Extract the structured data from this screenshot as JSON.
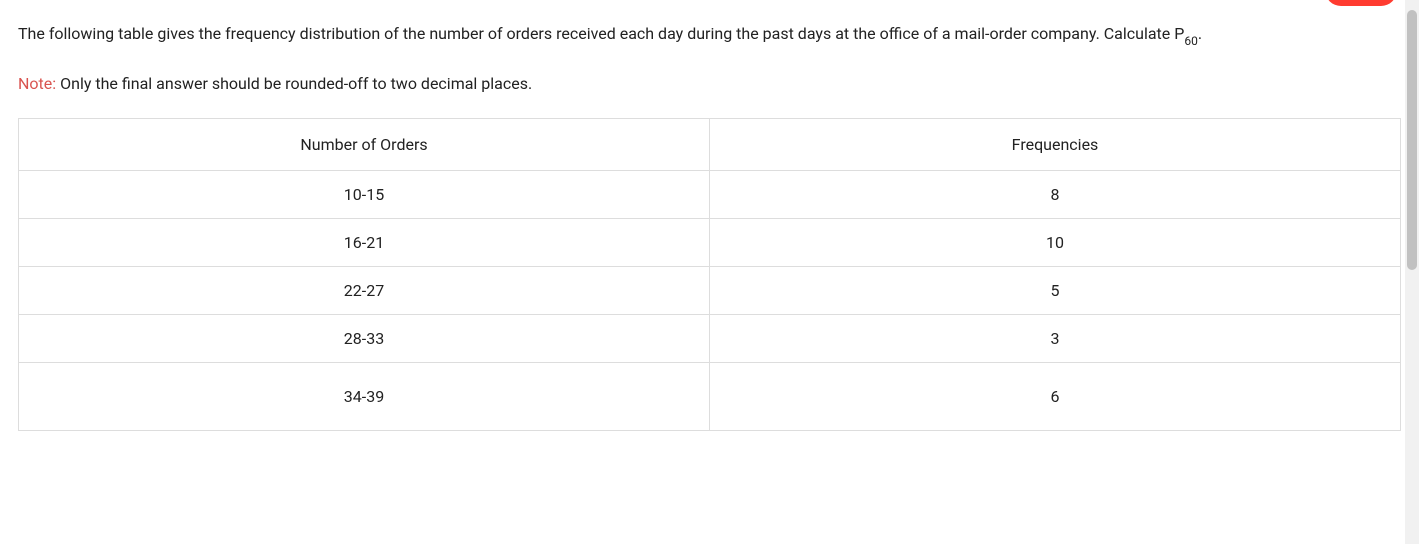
{
  "question": {
    "text_before_sub": "The following table gives the frequency distribution of the number of orders received each day during the past days at the office of a mail-order company. Calculate P",
    "sub": "60",
    "text_after_sub": "."
  },
  "note": {
    "label": "Note:",
    "text": " Only the final answer should be rounded-off to two decimal places."
  },
  "table": {
    "headers": {
      "col1": "Number of Orders",
      "col2": "Frequencies"
    },
    "rows": [
      {
        "orders": "10-15",
        "freq": "8"
      },
      {
        "orders": "16-21",
        "freq": "10"
      },
      {
        "orders": "22-27",
        "freq": "5"
      },
      {
        "orders": "28-33",
        "freq": "3"
      },
      {
        "orders": "34-39",
        "freq": "6"
      }
    ]
  }
}
